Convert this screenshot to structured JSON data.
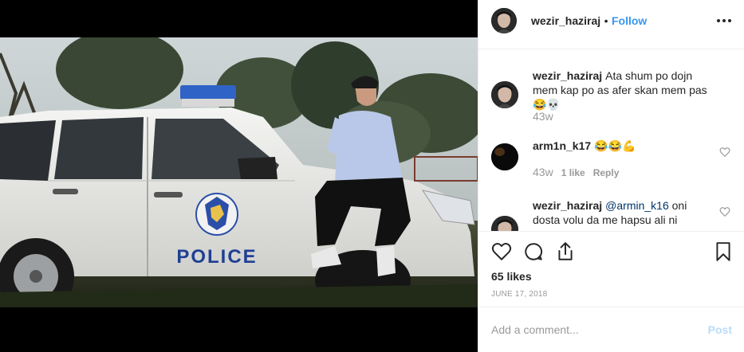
{
  "header": {
    "username": "wezir_haziraj",
    "separator": "•",
    "follow_label": "Follow"
  },
  "photo": {
    "car_text": "POLICE"
  },
  "comments": [
    {
      "username": "wezir_haziraj",
      "text": "Ata shum po dojn mem kap po as afer skan mem pas 😂💀",
      "time": "43w"
    },
    {
      "username": "arm1n_k17",
      "text": "😂😂💪",
      "time": "43w",
      "likes": "1 like",
      "reply": "Reply"
    },
    {
      "username": "wezir_haziraj",
      "mention": "@armin_k16",
      "text": " oni dosta volu da me hapsu ali ni",
      "time": ""
    }
  ],
  "actions": {
    "likes": "65 likes",
    "date": "JUNE 17, 2018"
  },
  "add_comment": {
    "placeholder": "Add a comment...",
    "post_label": "Post"
  },
  "colors": {
    "accent": "#3897f0",
    "text": "#262626",
    "muted": "#999999",
    "border": "#efefef"
  },
  "icons": [
    "more-icon",
    "heart-icon",
    "comment-icon",
    "share-icon",
    "bookmark-icon"
  ]
}
